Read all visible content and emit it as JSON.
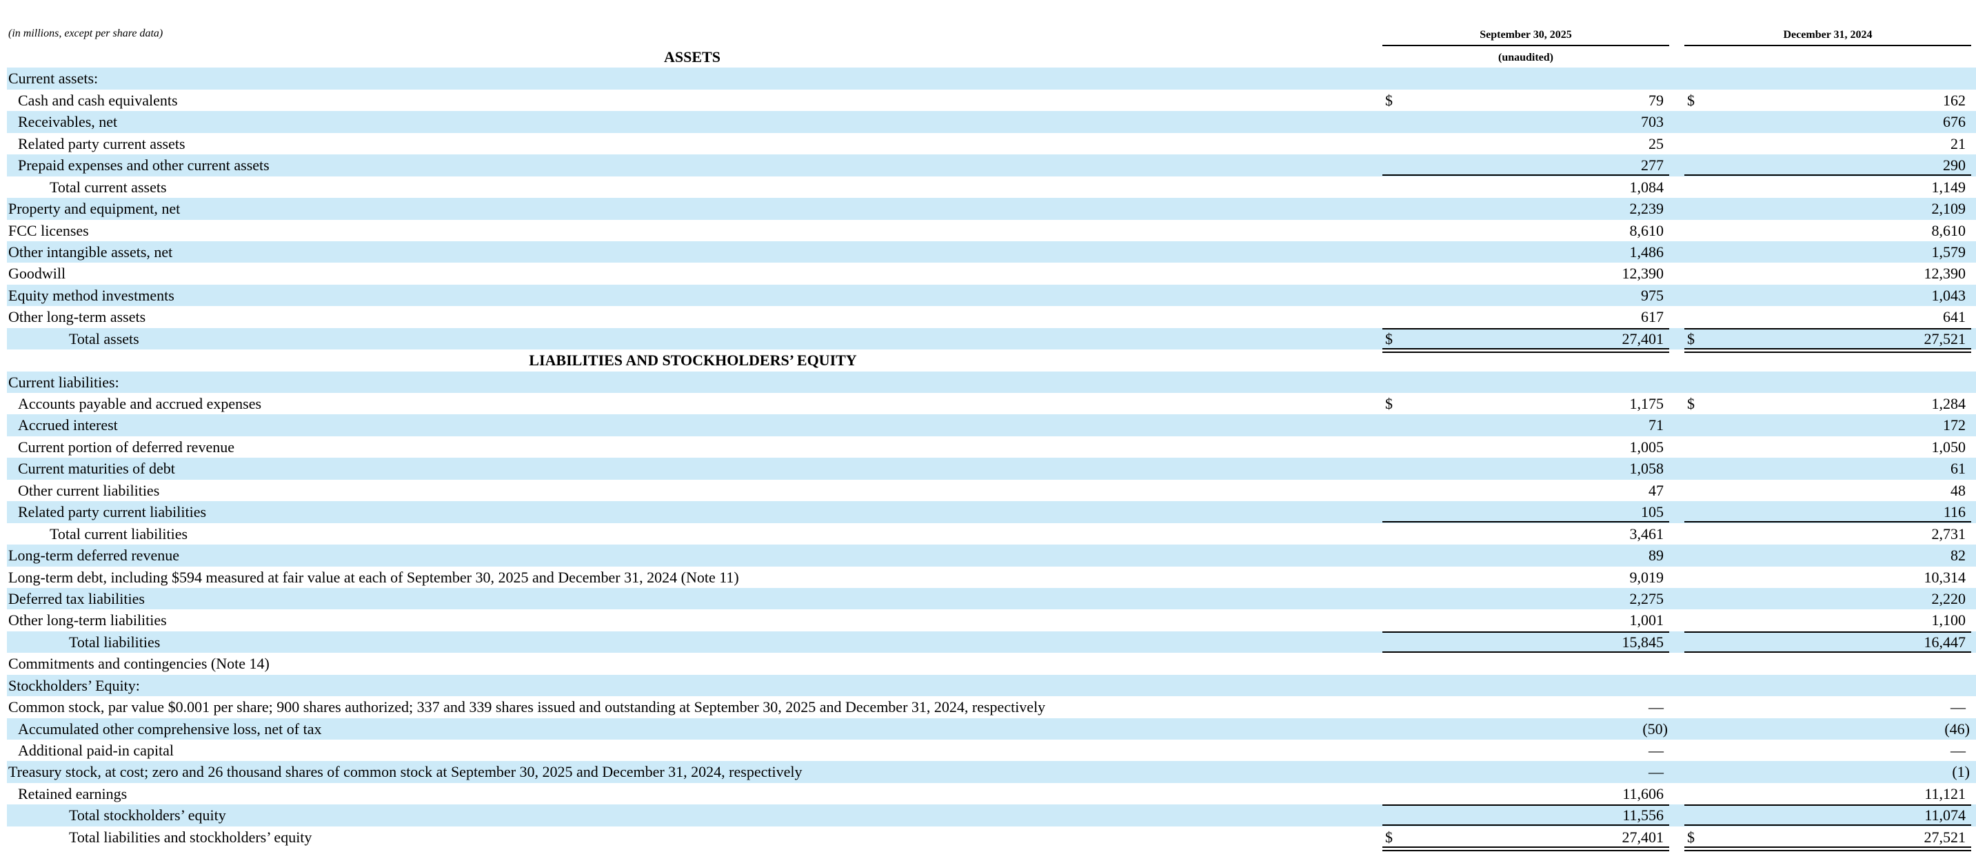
{
  "header": {
    "units_note": "(in millions, except per share data)",
    "col1": "September 30, 2025",
    "col1_sub": "(unaudited)",
    "col2": "December 31, 2024"
  },
  "sections": {
    "assets": "ASSETS",
    "liabilities": "LIABILITIES AND STOCKHOLDERS’ EQUITY"
  },
  "currency_symbol": "$",
  "rows": [
    {
      "label": "Current assets:"
    },
    {
      "label": "Cash and cash equivalents",
      "v1": "79",
      "v2": "162"
    },
    {
      "label": "Receivables, net",
      "v1": "703",
      "v2": "676"
    },
    {
      "label": "Related party current assets",
      "v1": "25",
      "v2": "21"
    },
    {
      "label": "Prepaid expenses and other current assets",
      "v1": "277",
      "v2": "290"
    },
    {
      "label": "Total current assets",
      "v1": "1,084",
      "v2": "1,149"
    },
    {
      "label": "Property and equipment, net",
      "v1": "2,239",
      "v2": "2,109"
    },
    {
      "label": "FCC licenses",
      "v1": "8,610",
      "v2": "8,610"
    },
    {
      "label": "Other intangible assets, net",
      "v1": "1,486",
      "v2": "1,579"
    },
    {
      "label": "Goodwill",
      "v1": "12,390",
      "v2": "12,390"
    },
    {
      "label": "Equity method investments",
      "v1": "975",
      "v2": "1,043"
    },
    {
      "label": "Other long-term assets",
      "v1": "617",
      "v2": "641"
    },
    {
      "label": "Total assets",
      "v1": "27,401",
      "v2": "27,521"
    },
    {
      "label": ""
    },
    {
      "label": "Current liabilities:"
    },
    {
      "label": "Accounts payable and accrued expenses",
      "v1": "1,175",
      "v2": "1,284"
    },
    {
      "label": "Accrued interest",
      "v1": "71",
      "v2": "172"
    },
    {
      "label": "Current portion of deferred revenue",
      "v1": "1,005",
      "v2": "1,050"
    },
    {
      "label": "Current maturities of debt",
      "v1": "1,058",
      "v2": "61"
    },
    {
      "label": "Other current liabilities",
      "v1": "47",
      "v2": "48"
    },
    {
      "label": "Related party current liabilities",
      "v1": "105",
      "v2": "116"
    },
    {
      "label": "Total current liabilities",
      "v1": "3,461",
      "v2": "2,731"
    },
    {
      "label": "Long-term deferred revenue",
      "v1": "89",
      "v2": "82"
    },
    {
      "label": "Long-term debt, including $594 measured at fair value at each of September 30, 2025 and December 31, 2024 (Note 11)",
      "v1": "9,019",
      "v2": "10,314"
    },
    {
      "label": "Deferred tax liabilities",
      "v1": "2,275",
      "v2": "2,220"
    },
    {
      "label": "Other long-term liabilities",
      "v1": "1,001",
      "v2": "1,100"
    },
    {
      "label": "Total liabilities",
      "v1": "15,845",
      "v2": "16,447"
    },
    {
      "label": "Commitments and contingencies (Note 14)"
    },
    {
      "label": "Stockholders’ Equity:"
    },
    {
      "label": "Common stock, par value $0.001 per share; 900 shares authorized; 337 and 339 shares issued and outstanding at September 30, 2025 and December 31, 2024, respectively",
      "v1": "—",
      "v2": "—"
    },
    {
      "label": "Accumulated other comprehensive loss, net of tax",
      "v1": "(50)",
      "v2": "(46)"
    },
    {
      "label": "Additional paid-in capital",
      "v1": "—",
      "v2": "—"
    },
    {
      "label": "Treasury stock, at cost; zero and 26 thousand shares of common stock at September 30, 2025 and December 31, 2024, respectively",
      "v1": "—",
      "v2": "(1)"
    },
    {
      "label": "Retained earnings",
      "v1": "11,606",
      "v2": "11,121"
    },
    {
      "label": "Total stockholders’ equity",
      "v1": "11,556",
      "v2": "11,074"
    },
    {
      "label": "Total liabilities and stockholders’ equity",
      "v1": "27,401",
      "v2": "27,521"
    }
  ]
}
